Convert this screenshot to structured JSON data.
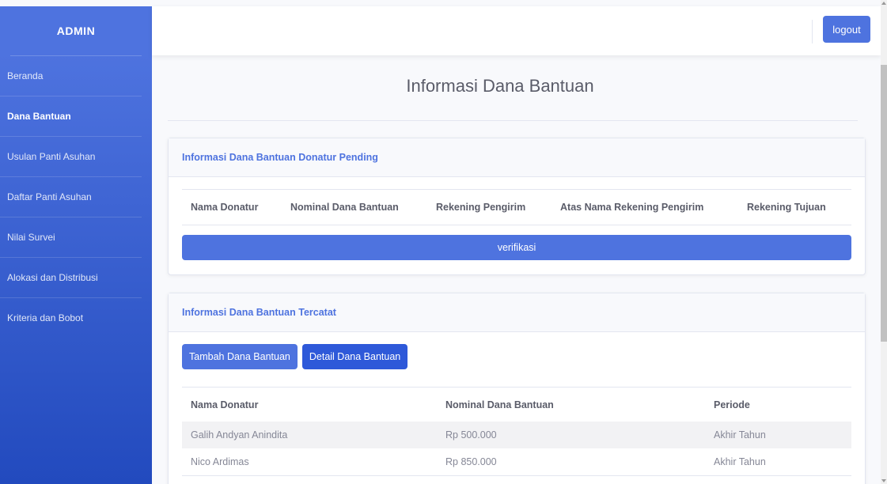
{
  "sidebar": {
    "brand": "ADMIN",
    "items": [
      {
        "label": "Beranda",
        "active": false
      },
      {
        "label": "Dana Bantuan",
        "active": true
      },
      {
        "label": "Usulan Panti Asuhan",
        "active": false
      },
      {
        "label": "Daftar Panti Asuhan",
        "active": false
      },
      {
        "label": "Nilai Survei",
        "active": false
      },
      {
        "label": "Alokasi dan Distribusi",
        "active": false
      },
      {
        "label": "Kriteria dan Bobot",
        "active": false
      }
    ]
  },
  "topbar": {
    "logout_label": "logout"
  },
  "page": {
    "title": "Informasi Dana Bantuan"
  },
  "pending_card": {
    "title": "Informasi Dana Bantuan Donatur Pending",
    "columns": [
      "Nama Donatur",
      "Nominal Dana Bantuan",
      "Rekening Pengirim",
      "Atas Nama Rekening Pengirim",
      "Rekening Tujuan"
    ],
    "verify_label": "verifikasi"
  },
  "recorded_card": {
    "title": "Informasi Dana Bantuan Tercatat",
    "add_label": "Tambah Dana Bantuan",
    "detail_label": "Detail Dana Bantuan",
    "columns": [
      "Nama Donatur",
      "Nominal Dana Bantuan",
      "Periode"
    ],
    "rows": [
      [
        "Galih Andyan Anindita",
        "Rp 500.000",
        "Akhir Tahun"
      ],
      [
        "Nico Ardimas",
        "Rp 850.000",
        "Akhir Tahun"
      ]
    ]
  },
  "colors": {
    "primary": "#4e73df",
    "sidebar_bottom": "#224abe",
    "text": "#5a5c69"
  }
}
